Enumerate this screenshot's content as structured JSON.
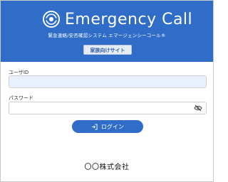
{
  "header": {
    "app_title": "Emergency Call",
    "subtitle": "緊急連絡/安否確認システム エマージェンシーコール®",
    "badge": "家族向けサイト"
  },
  "form": {
    "userid_label": "ユーザID",
    "userid_value": "",
    "password_label": "パスワード",
    "password_value": "",
    "password_toggle_icon": "eye-off-icon",
    "login_label": "ログイン",
    "login_icon": "login-icon"
  },
  "footer": {
    "company": "〇〇株式会社"
  },
  "colors": {
    "header_bg": "#2f6dc8",
    "button_bg": "#2f6dc8",
    "input_autofill_bg": "#e8f0fe"
  }
}
